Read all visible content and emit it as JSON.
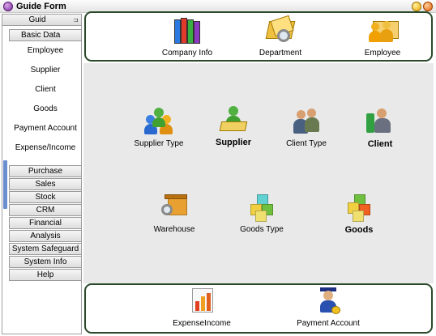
{
  "window": {
    "title": "Guide Form"
  },
  "sidebar": {
    "header": "Guid",
    "groups": [
      {
        "label": "Basic Data",
        "items": [
          "Employee",
          "Supplier",
          "Client",
          "Goods",
          "Payment Account",
          "Expense/Income"
        ]
      },
      {
        "label": "Purchase"
      },
      {
        "label": "Sales"
      },
      {
        "label": "Stock"
      },
      {
        "label": "CRM"
      },
      {
        "label": "Financial"
      },
      {
        "label": "Analysis"
      },
      {
        "label": "System Safeguard"
      },
      {
        "label": "System Info"
      },
      {
        "label": "Help"
      }
    ]
  },
  "top_panel": {
    "tiles": [
      "Company Info",
      "Department",
      "Employee"
    ]
  },
  "workspace": {
    "tiles": [
      "Supplier Type",
      "Supplier",
      "Client Type",
      "Client",
      "Warehouse",
      "Goods Type",
      "Goods"
    ]
  },
  "bottom_panel": {
    "tiles": [
      "ExpenseIncome",
      "Payment Account"
    ]
  }
}
